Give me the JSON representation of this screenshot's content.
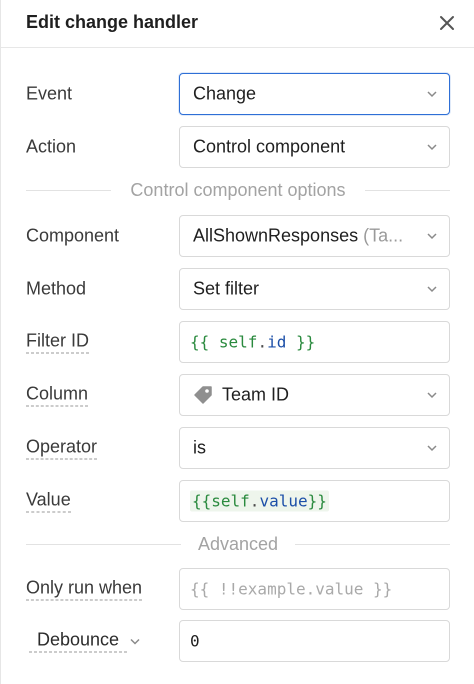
{
  "header": {
    "title": "Edit change handler"
  },
  "rows": {
    "event": {
      "label": "Event",
      "value": "Change"
    },
    "action": {
      "label": "Action",
      "value": "Control component"
    },
    "component": {
      "label": "Component",
      "value": "AllShownResponses",
      "suffix": " (Ta..."
    },
    "method": {
      "label": "Method",
      "value": "Set filter"
    },
    "filter_id": {
      "label": "Filter ID",
      "code_open": "{{ ",
      "code_ident": "self",
      "code_dot": ".",
      "code_prop": "id",
      "code_close": " }}"
    },
    "column": {
      "label": "Column",
      "value": "Team ID",
      "icon": "tag-icon"
    },
    "operator": {
      "label": "Operator",
      "value": "is"
    },
    "value": {
      "label": "Value",
      "code_open": "{{",
      "code_ident": "self",
      "code_dot": ".",
      "code_prop": "value",
      "code_close": "}}"
    },
    "only_run": {
      "label": "Only run when",
      "placeholder": "{{ !!example.value }}"
    },
    "debounce": {
      "label": "Debounce",
      "value": "0"
    }
  },
  "dividers": {
    "control_options": "Control component options",
    "advanced": "Advanced"
  },
  "colors": {
    "focus_border": "#2e6fd6",
    "code_green": "#2a8a3e",
    "code_blue": "#1c4fa8"
  }
}
